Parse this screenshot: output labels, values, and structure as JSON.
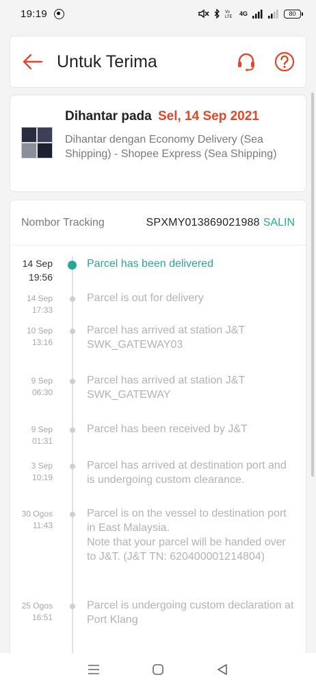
{
  "status_bar": {
    "time": "19:19",
    "network": "4G",
    "battery": "80",
    "icons": [
      "whatsapp-icon",
      "mute-icon",
      "bluetooth-icon",
      "volte-icon",
      "signal-icon",
      "battery-icon"
    ]
  },
  "header": {
    "title": "Untuk Terima",
    "icons": [
      "back-arrow-icon",
      "headset-icon",
      "help-icon"
    ]
  },
  "delivery": {
    "label": "Dihantar pada",
    "date": "Sel, 14 Sep 2021",
    "description": "Dihantar dengan Economy Delivery (Sea Shipping) - Shopee Express (Sea Shipping)"
  },
  "tracking": {
    "label": "Nombor Tracking",
    "number": "SPXMY013869021988",
    "copy_label": "SALIN",
    "events": [
      {
        "date": "14 Sep",
        "time": "19:56",
        "text": "Parcel has been delivered"
      },
      {
        "date": "14 Sep",
        "time": "17:33",
        "text": "Parcel is out for delivery"
      },
      {
        "date": "10 Sep",
        "time": "13:16",
        "text": "Parcel has arrived at station J&T SWK_GATEWAY03"
      },
      {
        "date": "9 Sep",
        "time": "06:30",
        "text": "Parcel has arrived at station J&T SWK_GATEWAY"
      },
      {
        "date": "9 Sep",
        "time": "01:31",
        "text": "Parcel has been received by J&T"
      },
      {
        "date": "3 Sep",
        "time": "10:19",
        "text": "Parcel has arrived at destination port and is undergoing custom clearance."
      },
      {
        "date": "30 Ogos",
        "time": "11:43",
        "text": "Parcel is on the vessel to destination port in East Malaysia.\nNote that your parcel will be handed over to J&T. (J&T TN: 620400001214804)"
      },
      {
        "date": "25 Ogos",
        "time": "16:51",
        "text": "Parcel is undergoing custom declaration at Port Klang"
      }
    ]
  },
  "colors": {
    "accent_orange": "#e0462a",
    "accent_green": "#26a893"
  }
}
